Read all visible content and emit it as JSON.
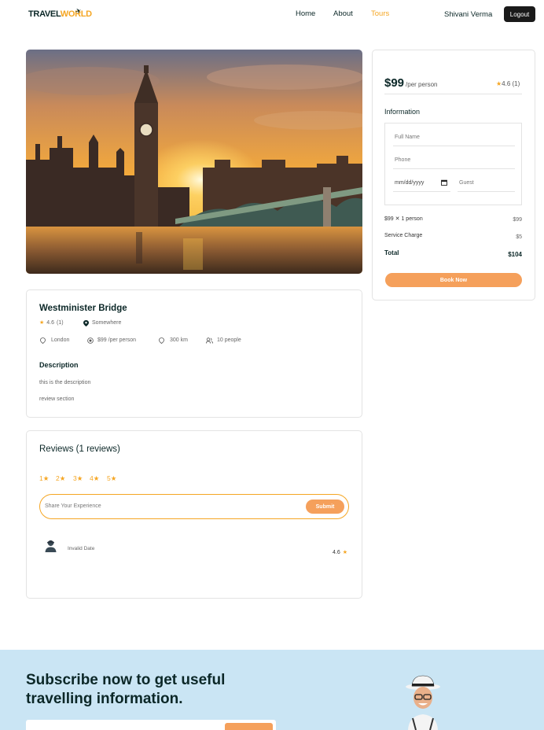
{
  "nav": {
    "logo_part1": "TRAVEL",
    "logo_part2": "WORLD",
    "links": [
      {
        "label": "Home",
        "active": false
      },
      {
        "label": "About",
        "active": false
      },
      {
        "label": "Tours",
        "active": true
      }
    ],
    "user_name": "Shivani Verma",
    "logout_label": "Logout"
  },
  "tour": {
    "title": "Westminister Bridge",
    "rating": "4.6",
    "rating_count": "(1)",
    "address": "Somewhere",
    "city": "London",
    "price_text": "$99 /per person",
    "distance": "300 km",
    "group_size": "10 people",
    "description_heading": "Description",
    "description": "this is the description",
    "review_section_text": "review section"
  },
  "reviews": {
    "heading": "Reviews (1 reviews)",
    "star_options": [
      "1★",
      "2★",
      "3★",
      "4★",
      "5★"
    ],
    "input_placeholder": "Share Your Experience",
    "submit_label": "Submit",
    "items": [
      {
        "date": "Invalid Date",
        "rating": "4.6"
      }
    ]
  },
  "booking": {
    "price": "$99",
    "per_person": "/per person",
    "rating": "4.6 (1)",
    "info_heading": "Information",
    "fullname_placeholder": "Full Name",
    "phone_placeholder": "Phone",
    "date_placeholder": "mm/dd/yyyy",
    "guest_placeholder": "Guest",
    "line1_label": "$99",
    "line1_mult": "1 person",
    "line1_value": "$99",
    "service_label": "Service Charge",
    "service_value": "$5",
    "total_label": "Total",
    "total_value": "$104",
    "book_label": "Book Now"
  },
  "newsletter": {
    "title": "Subscribe now to get useful travelling information."
  },
  "colors": {
    "accent": "#f5a623",
    "button": "#f5a05b",
    "heading": "#0b2727",
    "newsletter_bg": "#cae5f4"
  }
}
